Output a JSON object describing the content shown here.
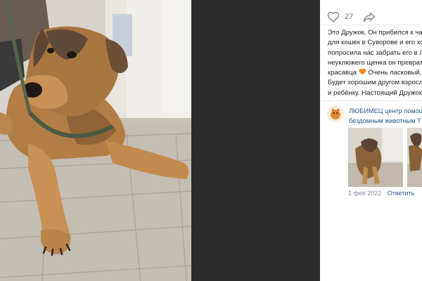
{
  "post": {
    "likes_count": "27",
    "description_lines": [
      "Это Дружок. Он прибился к час",
      "для кошек в Суворове и его хоз",
      "попросила нас забрать его в Л",
      "неуклюжего щенка он превратил",
      "красавца",
      " Очень ласковый,",
      "Будет хорошим другом взросл",
      "и ребёнку. Настоящий Дружок"
    ]
  },
  "comment": {
    "author_line1": "ЛЮБИМЕЦ центр помощ",
    "author_line2": "бездомным животным Т",
    "date": "1 фев 2022",
    "reply_label": "Ответить"
  },
  "icons": {
    "like": "heart-outline-icon",
    "share": "share-arrow-icon",
    "emoji": "orange-heart-emoji"
  },
  "colors": {
    "link": "#2a5885",
    "muted": "#818c99",
    "divider": "#e7e8ec",
    "dark_pane": "#2b2b2b"
  }
}
